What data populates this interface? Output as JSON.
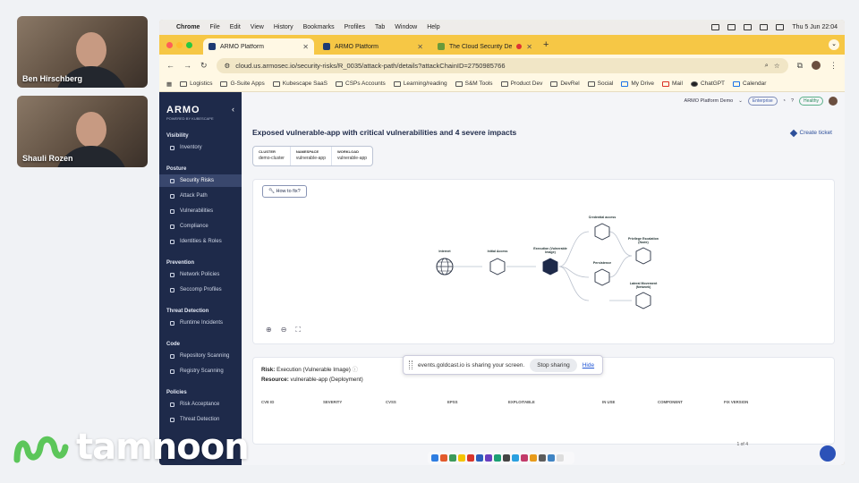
{
  "participants": [
    {
      "name": "Ben Hirschberg"
    },
    {
      "name": "Shauli Rozen"
    }
  ],
  "menubar": {
    "app": "Chrome",
    "items": [
      "File",
      "Edit",
      "View",
      "History",
      "Bookmarks",
      "Profiles",
      "Tab",
      "Window",
      "Help"
    ],
    "clock": "Thu 5 Jun  22:04"
  },
  "tabs": [
    {
      "title": "ARMO Platform",
      "active": true
    },
    {
      "title": "ARMO Platform",
      "active": false
    },
    {
      "title": "The Cloud Security Demo",
      "active": false
    }
  ],
  "address": {
    "url": "cloud.us.armosec.io/security-risks/R_0035/attack-path/details?attackChainID=2750985766"
  },
  "bookmarks": [
    "Logistics",
    "G-Suite Apps",
    "Kubescape SaaS",
    "CSPs Accounts",
    "Learning/reading",
    "S&M Tools",
    "Product Dev",
    "DevRel",
    "Social",
    "My Drive",
    "Mail",
    "ChatGPT",
    "Calendar"
  ],
  "brand": {
    "logo": "ARMO",
    "sub": "POWERED BY KUBESCAPE"
  },
  "sidebar": [
    {
      "section": "Visibility",
      "items": [
        {
          "label": "Inventory",
          "icon": "inventory-icon"
        }
      ]
    },
    {
      "section": "Posture",
      "items": [
        {
          "label": "Security Risks",
          "icon": "risk-icon",
          "active": true
        },
        {
          "label": "Attack Path",
          "icon": "path-icon"
        },
        {
          "label": "Vulnerabilities",
          "icon": "bug-icon"
        },
        {
          "label": "Compliance",
          "icon": "compliance-icon"
        },
        {
          "label": "Identities & Roles",
          "icon": "identity-icon"
        }
      ]
    },
    {
      "section": "Prevention",
      "items": [
        {
          "label": "Network Policies",
          "icon": "network-icon"
        },
        {
          "label": "Seccomp Profiles",
          "icon": "seccomp-icon"
        }
      ]
    },
    {
      "section": "Threat Detection",
      "items": [
        {
          "label": "Runtime Incidents",
          "icon": "incident-icon"
        }
      ]
    },
    {
      "section": "Code",
      "items": [
        {
          "label": "Repository Scanning",
          "icon": "repo-icon"
        },
        {
          "label": "Registry Scanning",
          "icon": "registry-icon"
        }
      ]
    },
    {
      "section": "Policies",
      "items": [
        {
          "label": "Risk Acceptance",
          "icon": "accept-icon"
        },
        {
          "label": "Threat Detection",
          "icon": "shield-icon"
        }
      ]
    }
  ],
  "topbar": {
    "account": "ARMO Platform Demo",
    "plan": "Enterprise",
    "health": "Healthy"
  },
  "page": {
    "title": "Exposed vulnerable-app with critical vulnerabilities and 4 severe impacts",
    "create_ticket": "Create ticket",
    "meta": [
      {
        "key": "CLUSTER",
        "value": "demo-cluster"
      },
      {
        "key": "NAMESPACE",
        "value": "vulnerable-app"
      },
      {
        "key": "WORKLOAD",
        "value": "vulnerable-app"
      }
    ],
    "how_to_fix": "How to fix?"
  },
  "graph": {
    "labels": {
      "internet": "Internet",
      "initial": "Initial Access",
      "execution": "Execution (Vulnerable Image)",
      "credential": "Credential access",
      "privilege": "Privilege Escalation (Node)",
      "persistence": "Persistence",
      "lateral": "Lateral Movement (Network)"
    }
  },
  "risk": {
    "risk_label": "Risk:",
    "risk_value": "Execution (Vulnerable Image)",
    "resource_label": "Resource:",
    "resource_value": "vulnerable-app (Deployment)",
    "columns": [
      "CVE ID",
      "SEVERITY",
      "CVSS",
      "EPSS",
      "EXPLOITABLE",
      "IN USE",
      "COMPONENT",
      "FIX VERSION"
    ],
    "pager": "1 of 4"
  },
  "share_banner": {
    "text": "events.goldcast.io is sharing your screen.",
    "stop": "Stop sharing",
    "hide": "Hide"
  },
  "overlay_logo": {
    "text": "tamnoon"
  },
  "colors": {
    "sidebar": "#1e2a4a",
    "accent": "#2d4f9a",
    "tabbar": "#f6c745"
  }
}
